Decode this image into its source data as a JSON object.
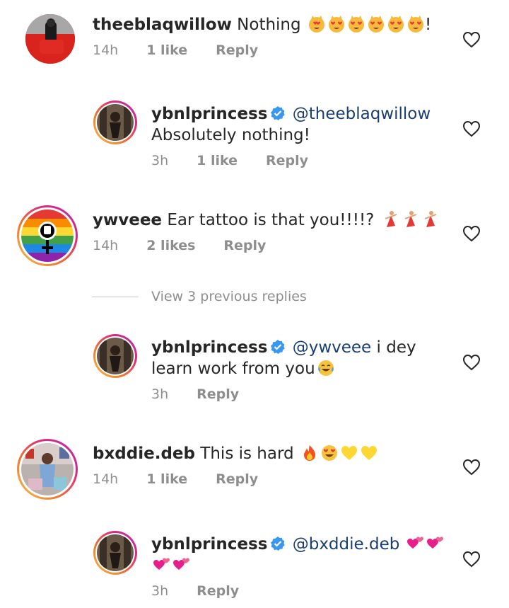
{
  "comments": [
    {
      "username": "theeblaqwillow",
      "text": "Nothing",
      "suffix": "!",
      "emoji_count": 6,
      "emoji": "heart-eyes-cat",
      "time": "14h",
      "likes": "1 like",
      "reply": "Reply"
    },
    {
      "username": "ybnlprincess",
      "mention": "@theeblaqwillow",
      "text": "Absolutely nothing!",
      "time": "3h",
      "likes": "1 like",
      "reply": "Reply"
    },
    {
      "username": "ywveee",
      "text": "Ear tattoo is that you!!!!?",
      "emoji": "dancer",
      "time": "14h",
      "likes": "2 likes",
      "reply": "Reply"
    },
    {
      "username": "ybnlprincess",
      "mention": "@ywveee",
      "text_line1": "i dey",
      "text_line2": "learn work from you",
      "emoji": "tears-of-joy",
      "time": "3h",
      "reply": "Reply"
    },
    {
      "username": "bxddie.deb",
      "text": "This is hard",
      "emoji": [
        "fire",
        "heart-eyes",
        "yellow-heart",
        "yellow-heart"
      ],
      "time": "14h",
      "likes": "1 like",
      "reply": "Reply"
    },
    {
      "username": "ybnlprincess",
      "mention": "@bxddie.deb",
      "emoji": "two-hearts",
      "time": "3h",
      "reply": "Reply"
    }
  ],
  "view_replies": "View 3 previous replies",
  "colors": {
    "verified": "#3897f0",
    "mention": "#1a3e70",
    "meta": "#8e8e8e"
  }
}
